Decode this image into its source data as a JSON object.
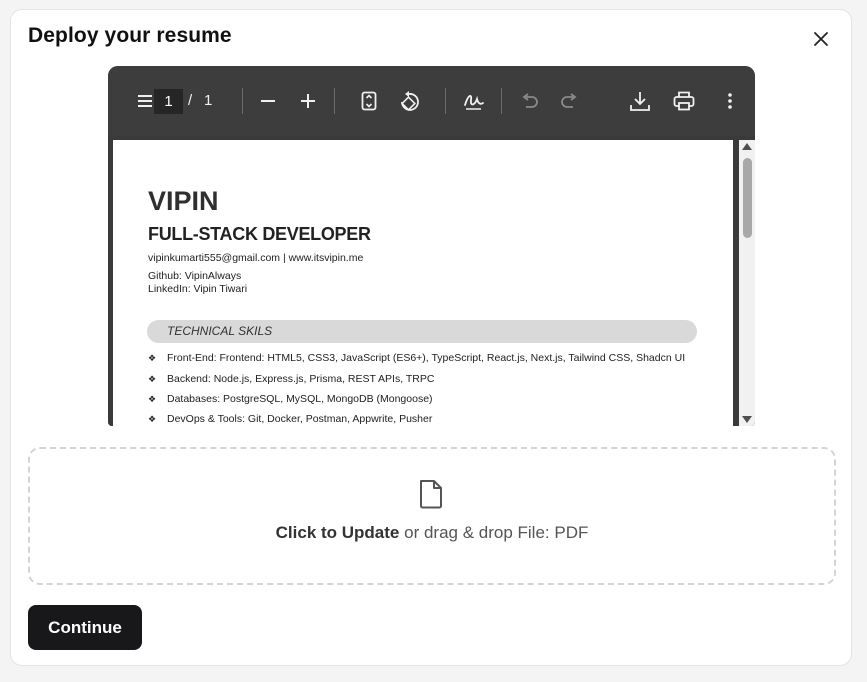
{
  "dialog": {
    "title": "Deploy your resume"
  },
  "viewer": {
    "page_current": "1",
    "page_separator": "/",
    "page_total": "1",
    "icons": [
      "menu-icon",
      "zoom-out-icon",
      "zoom-in-icon",
      "fit-page-icon",
      "rotate-icon",
      "draw-icon",
      "undo-icon",
      "redo-icon",
      "download-icon",
      "print-icon",
      "more-icon"
    ]
  },
  "resume": {
    "name": "VIPIN",
    "role": "FULL-STACK DEVELOPER",
    "contact": "vipinkumarti555@gmail.com | www.itsvipin.me",
    "github": "Github: VipinAlways",
    "linkedin": "LinkedIn: Vipin Tiwari",
    "section_title": "TECHNICAL SKILS",
    "bullet_char": "❖",
    "skills": [
      "Front-End: Frontend: HTML5, CSS3, JavaScript (ES6+), TypeScript, React.js, Next.js, Tailwind CSS, Shadcn UI",
      "Backend: Node.js, Express.js, Prisma, REST APIs, TRPC",
      "Databases: PostgreSQL, MySQL, MongoDB (Mongoose)",
      "DevOps & Tools: Git, Docker, Postman, Appwrite, Pusher"
    ]
  },
  "upload": {
    "action_label": "Click to Update",
    "hint": " or drag & drop File: PDF"
  },
  "actions": {
    "continue_label": "Continue"
  },
  "colors": {
    "primary_button": "#18181b",
    "viewer_toolbar": "#3d3d3d",
    "section_band": "#d9d9d9"
  }
}
